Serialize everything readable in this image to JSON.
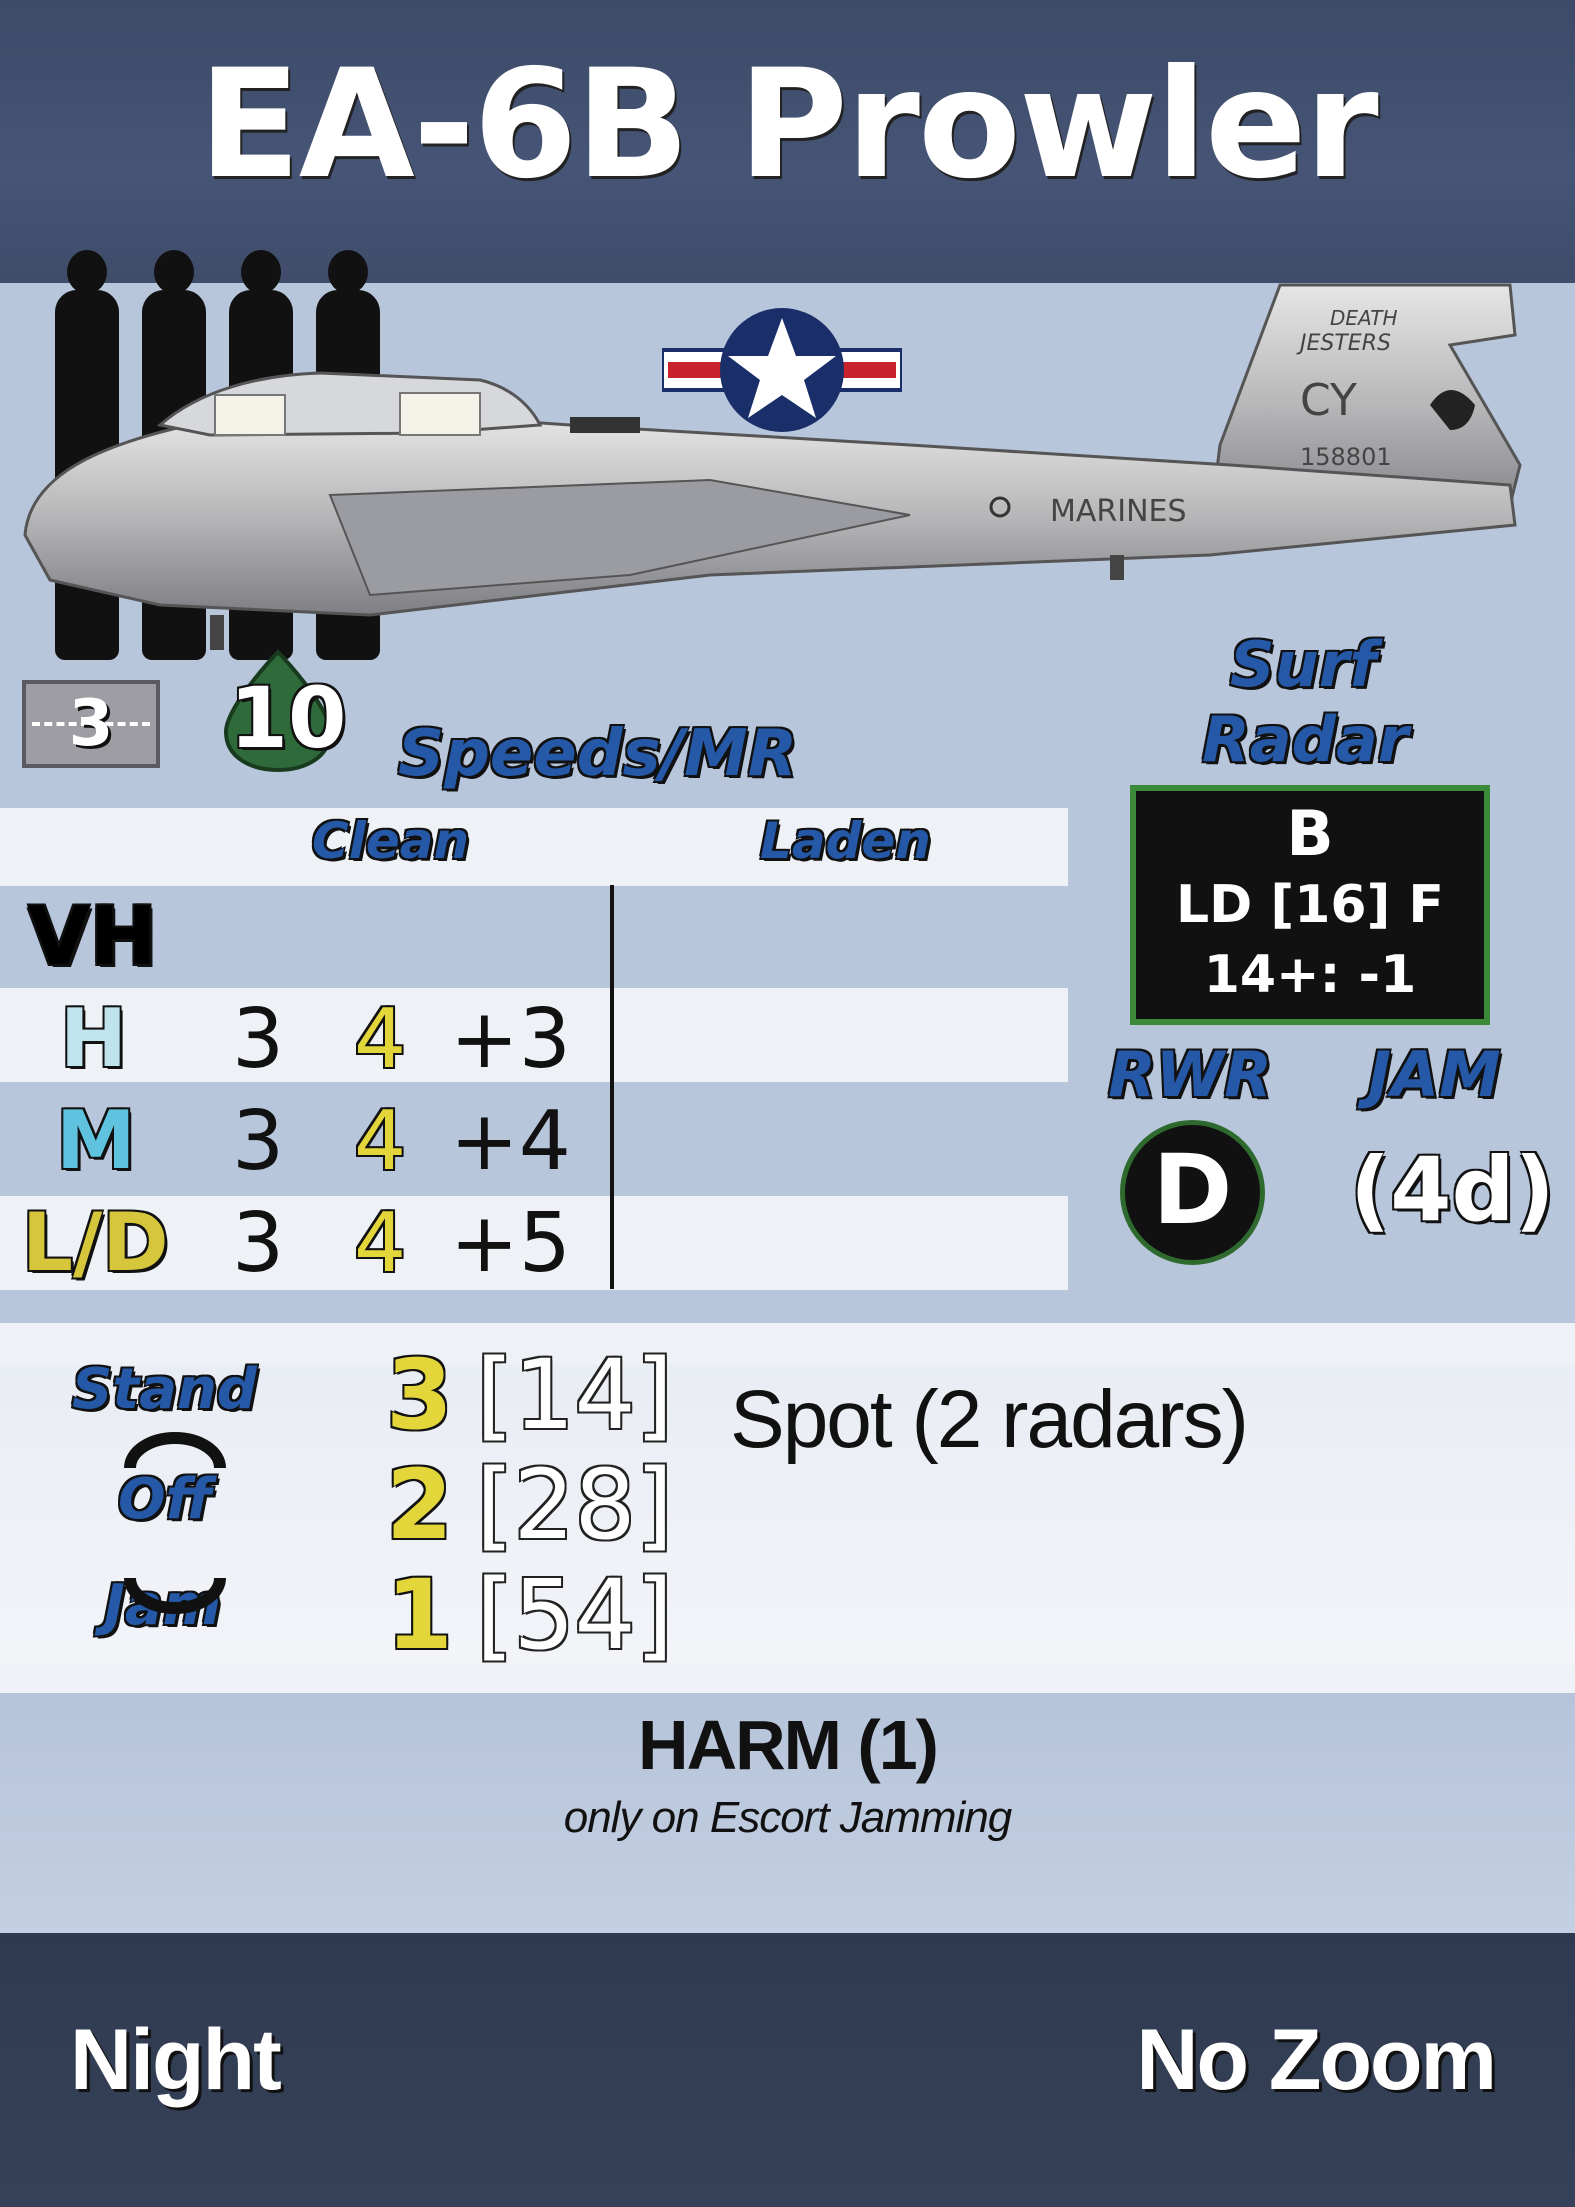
{
  "card": {
    "title": "EA-6B Prowler",
    "pilot_count": 4
  },
  "aircraft": {
    "tail_text_1": "DEATH",
    "tail_text_2": "JESTERS",
    "tail_code": "CY",
    "serial": "158801",
    "fuselage_text": "MARINES"
  },
  "stats": {
    "box_value": "3",
    "fuel_value": "10"
  },
  "speeds": {
    "title": "Speeds/MR",
    "col_clean": "Clean",
    "col_laden": "Laden",
    "rows": [
      {
        "label": "VH",
        "label_color": "#ffffff",
        "c1": "",
        "c2": "",
        "c3": ""
      },
      {
        "label": "H",
        "label_color": "#bfe4ee",
        "c1": "3",
        "c2": "4",
        "c3": "+3"
      },
      {
        "label": "M",
        "label_color": "#5fc3e0",
        "c1": "3",
        "c2": "4",
        "c3": "+4"
      },
      {
        "label": "L/D",
        "label_color": "#d6c63c",
        "c1": "3",
        "c2": "4",
        "c3": "+5"
      }
    ]
  },
  "radar": {
    "title_1": "Surf",
    "title_2": "Radar",
    "line_1": "B",
    "line_2": "LD [16] F",
    "line_3": "14+: -1"
  },
  "rwr": {
    "label": "RWR",
    "value": "D"
  },
  "jam": {
    "label": "JAM",
    "value": "(4d)"
  },
  "standoff": {
    "label_1": "Stand",
    "label_2": "Off",
    "label_3": "Jam",
    "rows": [
      {
        "level": "3",
        "range": "[14]"
      },
      {
        "level": "2",
        "range": "[28]"
      },
      {
        "level": "1",
        "range": "[54]"
      }
    ],
    "note": "Spot (2 radars)"
  },
  "weapon": {
    "name": "HARM (1)",
    "note": "only on Escort Jamming"
  },
  "footer": {
    "left": "Night",
    "right": "No Zoom"
  },
  "colors": {
    "header_band": "#3d4a68",
    "panel": "#b8c6db",
    "accent_blue": "#2559a8",
    "accent_yellow": "#e2d63a",
    "radar_border": "#3a8a3a"
  }
}
